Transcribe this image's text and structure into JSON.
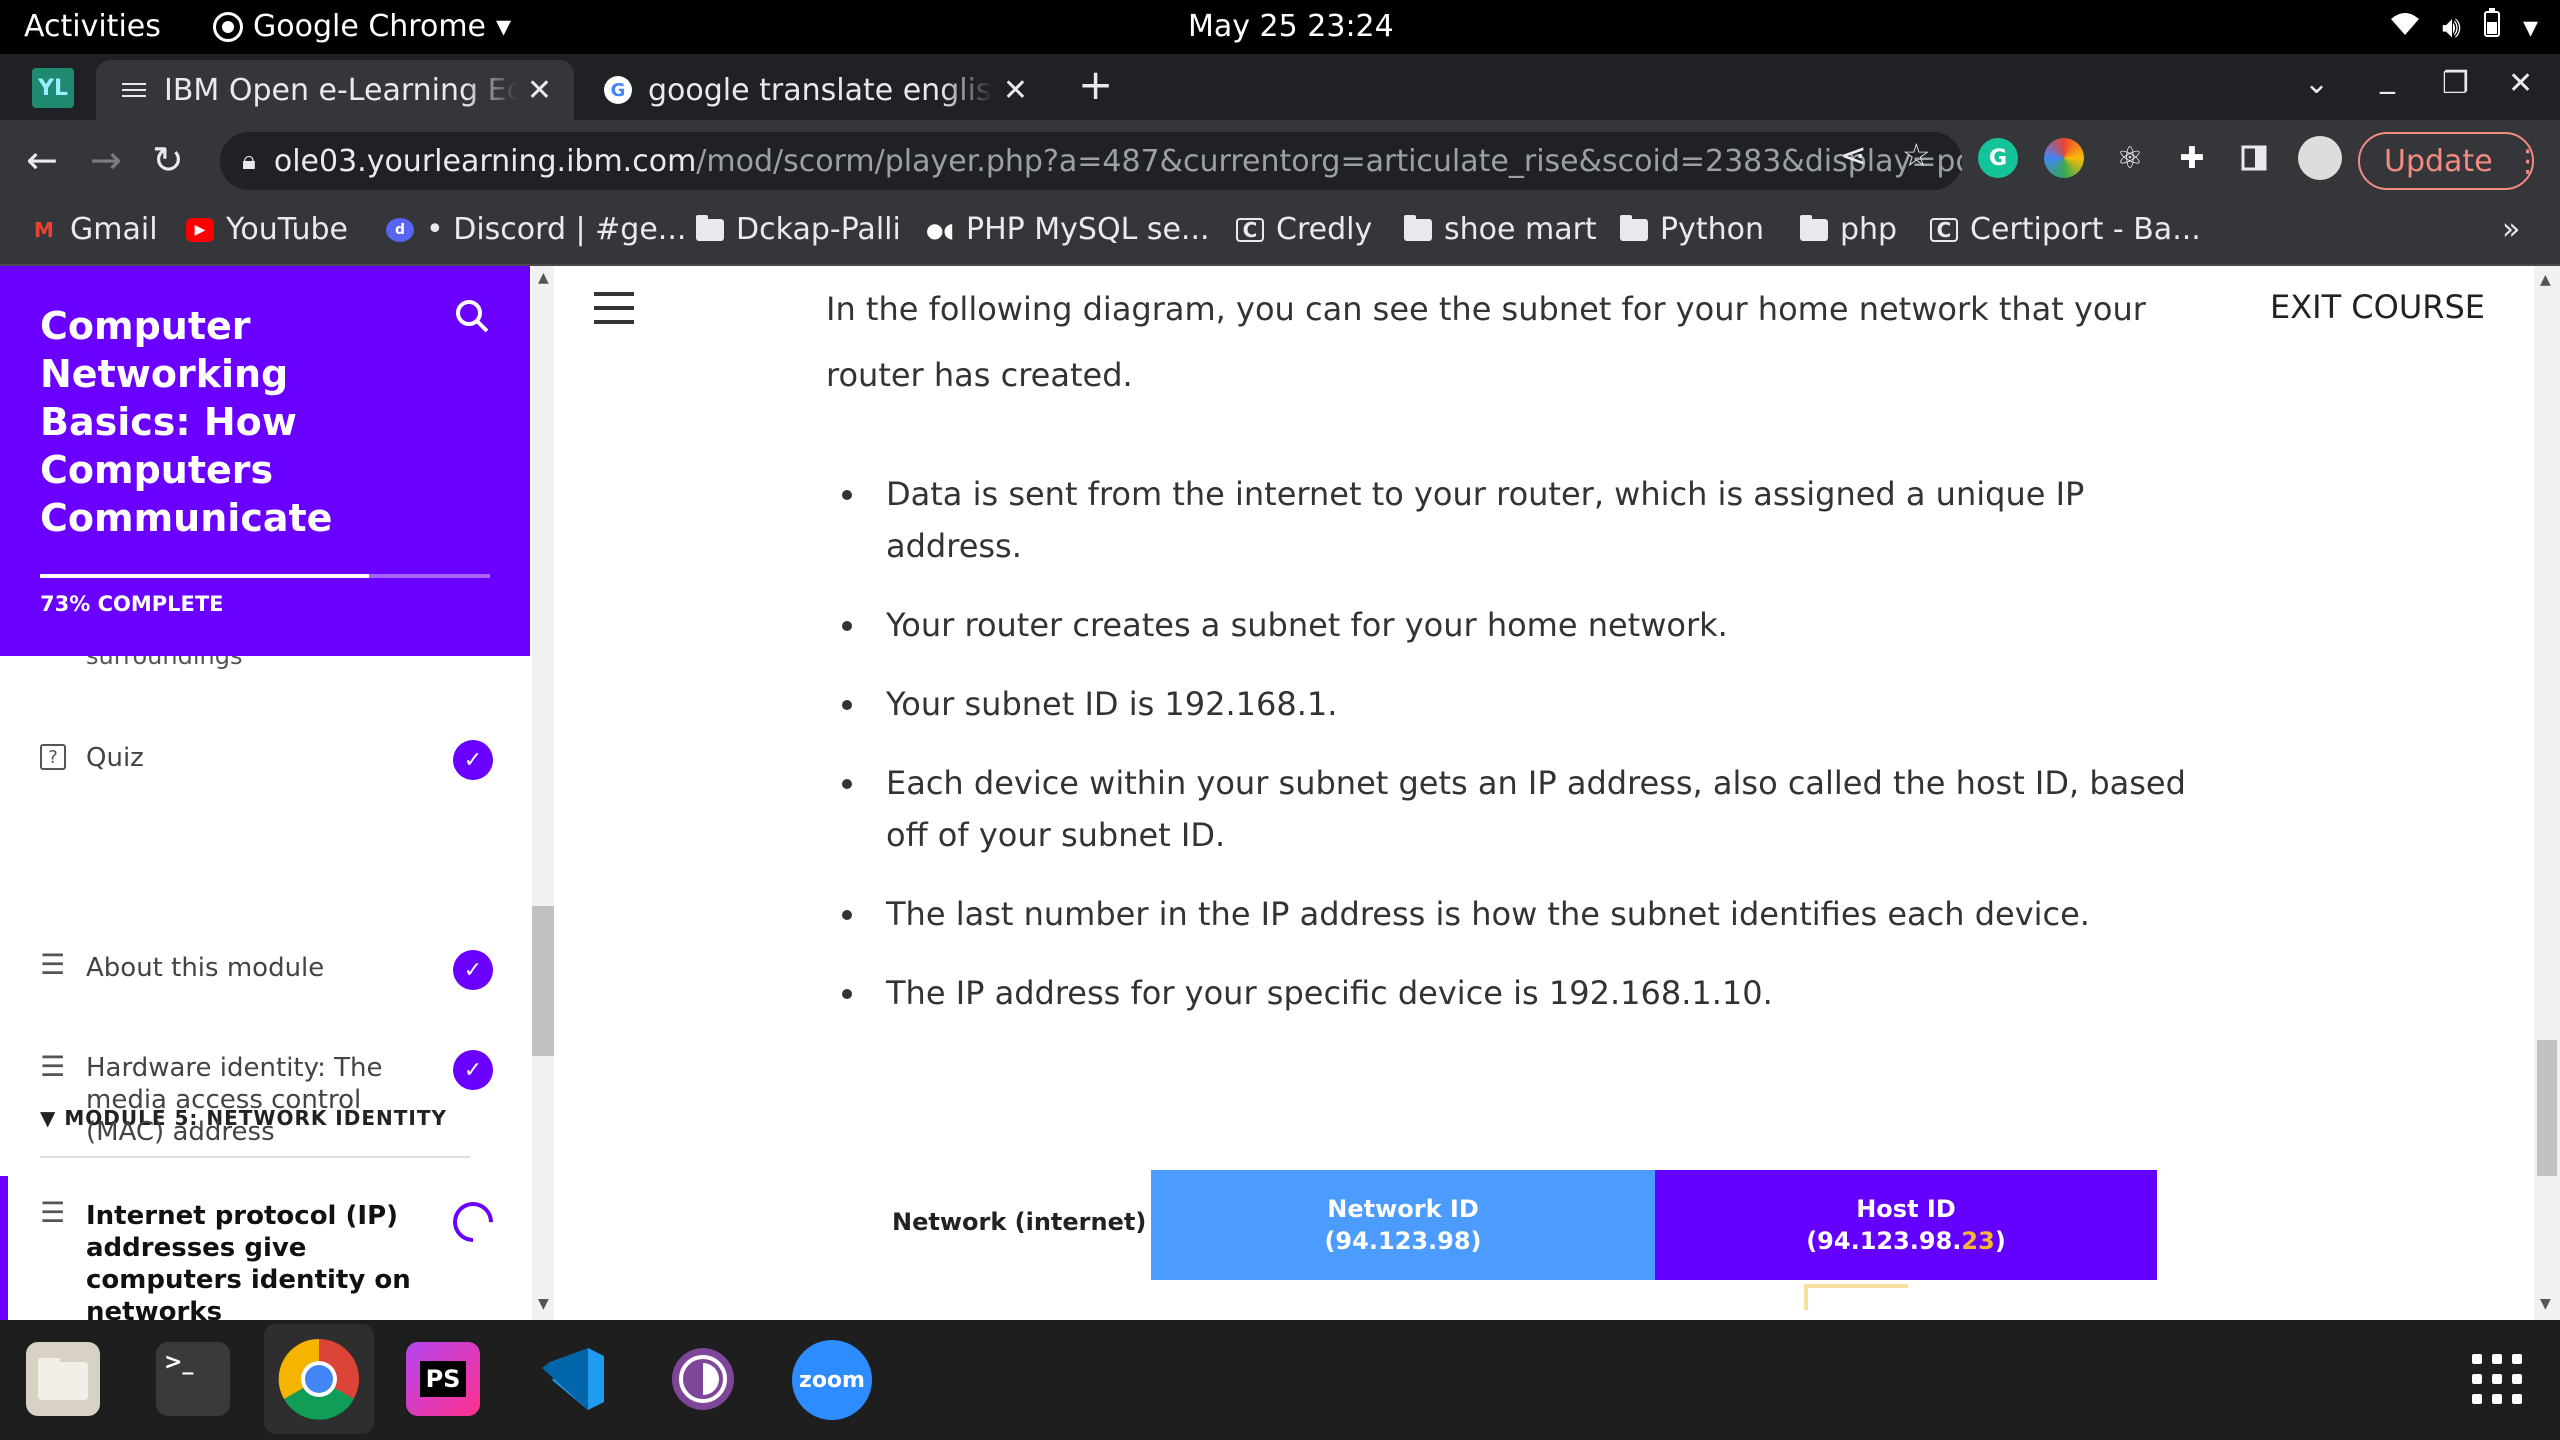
{
  "system": {
    "activities": "Activities",
    "app_menu": "Google Chrome",
    "clock": "May 25  23:24"
  },
  "tabs": [
    {
      "label": "IBM Open e-Learning Ecosystem",
      "active": true
    },
    {
      "label": "google translate english to",
      "active": false
    }
  ],
  "address": {
    "host": "ole03.yourlearning.ibm.com",
    "path": "/mod/scorm/player.php?a=487&currentorg=articulate_rise&scoid=2383&display=popup&..."
  },
  "update_label": "Update",
  "bookmarks": [
    {
      "label": "Gmail",
      "icon": "gmail-icon"
    },
    {
      "label": "YouTube",
      "icon": "youtube-icon"
    },
    {
      "label": "• Discord | #ge...",
      "icon": "discord-icon"
    },
    {
      "label": "Dckap-Palli",
      "icon": "folder-icon"
    },
    {
      "label": "PHP MySQL se...",
      "icon": "medium-icon"
    },
    {
      "label": "Credly",
      "icon": "credly-icon"
    },
    {
      "label": "shoe mart",
      "icon": "folder-icon"
    },
    {
      "label": "Python",
      "icon": "folder-icon"
    },
    {
      "label": "php",
      "icon": "folder-icon"
    },
    {
      "label": "Certiport - Ba...",
      "icon": "credly-icon"
    }
  ],
  "course": {
    "title": "Computer Networking Basics: How Computers Communicate",
    "progress_label": "73% COMPLETE",
    "progress": 0.73,
    "cut_text": "surroundings",
    "quiz_label": "Quiz",
    "module_label": "MODULE 5: NETWORK IDENTITY",
    "lessons": [
      {
        "label": "About this module"
      },
      {
        "label": "Hardware identity: The media access control (MAC) address"
      },
      {
        "label": "Internet protocol (IP) addresses give computers identity on networks"
      }
    ]
  },
  "content": {
    "exit_label": "EXIT COURSE",
    "intro": "In the following diagram, you can see the subnet for your home network that your router has created.",
    "bullets": [
      "Data is sent from the internet to your router, which is assigned a unique IP address.",
      "Your router creates a subnet for your home network.",
      "Your subnet ID is 192.168.1.",
      "Each device within your subnet gets an IP address, also called the host ID, based off of your subnet ID.",
      "The last number in the IP address is how the subnet identifies each device.",
      "The IP address for your specific device is 192.168.1.10."
    ],
    "diagram": {
      "network_label": "Network (internet)",
      "network_id_title": "Network ID",
      "network_id_value": "(94.123.98)",
      "host_id_title": "Host ID",
      "host_id_prefix": "(94.123.98.",
      "host_id_highlight": "23",
      "host_id_suffix": ")"
    }
  },
  "dock": [
    "files-icon",
    "terminal-icon",
    "chrome-icon",
    "phpstorm-icon",
    "vscode-icon",
    "tor-icon",
    "zoom-icon"
  ],
  "dock_zoom_label": "zoom",
  "dock_ps_label": "PS"
}
